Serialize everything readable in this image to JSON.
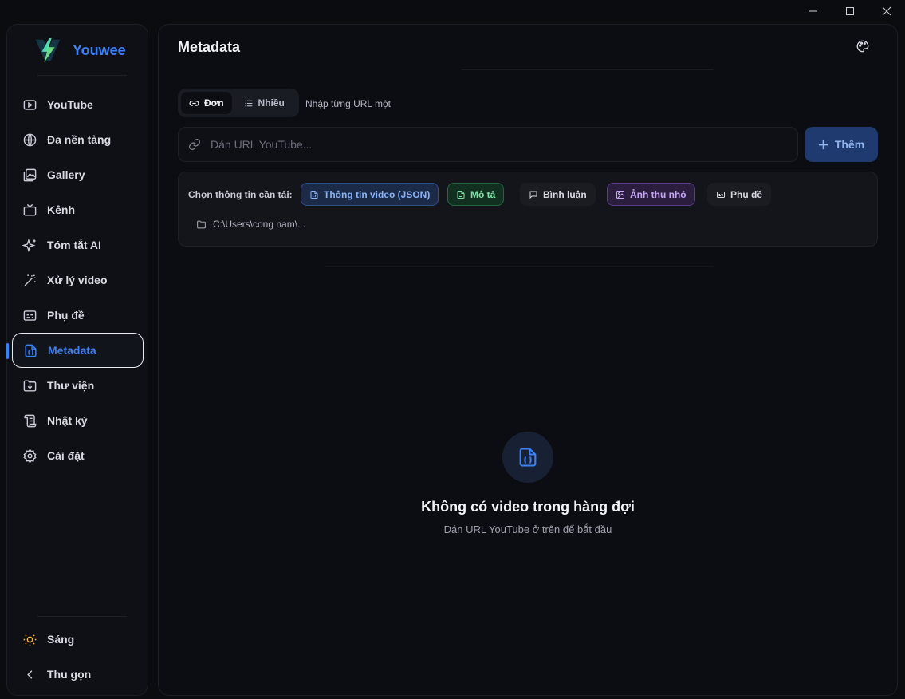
{
  "app": {
    "name": "Youwee"
  },
  "sidebar": {
    "items": [
      {
        "label": "YouTube",
        "icon": "play-square-icon"
      },
      {
        "label": "Đa nền tảng",
        "icon": "globe-icon"
      },
      {
        "label": "Gallery",
        "icon": "gallery-icon"
      },
      {
        "label": "Kênh",
        "icon": "tv-icon"
      },
      {
        "label": "Tóm tắt AI",
        "icon": "sparkles-icon"
      },
      {
        "label": "Xử lý video",
        "icon": "magic-wand-icon"
      },
      {
        "label": "Phụ đề",
        "icon": "captions-icon"
      },
      {
        "label": "Metadata",
        "icon": "file-json-icon",
        "active": true
      },
      {
        "label": "Thư viện",
        "icon": "download-folder-icon"
      },
      {
        "label": "Nhật ký",
        "icon": "scroll-icon"
      },
      {
        "label": "Cài đặt",
        "icon": "gear-icon"
      }
    ],
    "theme_label": "Sáng",
    "collapse_label": "Thu gọn"
  },
  "main": {
    "title": "Metadata",
    "mode": {
      "single": "Đơn",
      "multi": "Nhiều",
      "hint": "Nhập từng URL một"
    },
    "url_input": {
      "placeholder": "Dán URL YouTube...",
      "value": ""
    },
    "add_button": "Thêm",
    "options": {
      "label": "Chọn thông tin cần tải:",
      "chips": {
        "json": "Thông tin video (JSON)",
        "description": "Mô tả",
        "comments": "Bình luận",
        "thumbnail": "Ảnh thu nhỏ",
        "subtitles": "Phụ đề"
      },
      "path": "C:\\Users\\cong nam\\..."
    },
    "empty": {
      "title": "Không có video trong hàng đợi",
      "subtitle": "Dán URL YouTube ở trên để bắt đầu"
    }
  },
  "colors": {
    "accent": "#3b82f6",
    "background": "#0b0c10"
  }
}
